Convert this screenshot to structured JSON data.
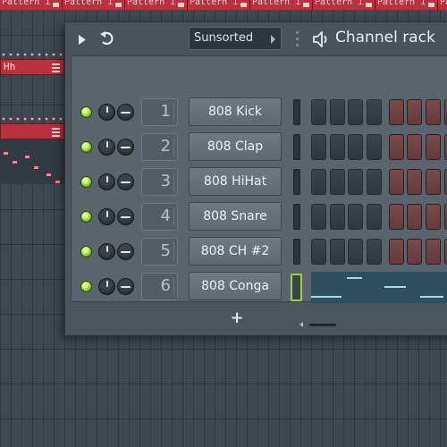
{
  "playlist": {
    "pattern_clips": [
      "Pattern 1",
      "Pattern 1",
      "Pattern 1",
      "Pattern 1",
      "Pattern 1",
      "Pattern 1",
      "Pattern 1",
      "Pattern 1"
    ],
    "track_label": "Hh"
  },
  "channel_rack": {
    "group_selector": "Sunsorted",
    "title": "Channel rack",
    "channels": [
      {
        "number": "1",
        "name": "808 Kick"
      },
      {
        "number": "2",
        "name": "808 Clap"
      },
      {
        "number": "3",
        "name": "808 HiHat"
      },
      {
        "number": "4",
        "name": "808 Snare"
      },
      {
        "number": "5",
        "name": "808 CH #2"
      },
      {
        "number": "6",
        "name": "808 Conga"
      }
    ],
    "add_button": "+"
  },
  "colors": {
    "accent_green": "#9ad33c",
    "pattern_red": "#b8313c",
    "step_red": "#7a4a4d",
    "step_dark": "#3c454d"
  },
  "icons": {
    "play": "play-icon",
    "undo": "undo-icon",
    "speaker": "speaker-icon",
    "dropdown_arrow": "chevron-right-icon",
    "menu": "menu-icon"
  }
}
